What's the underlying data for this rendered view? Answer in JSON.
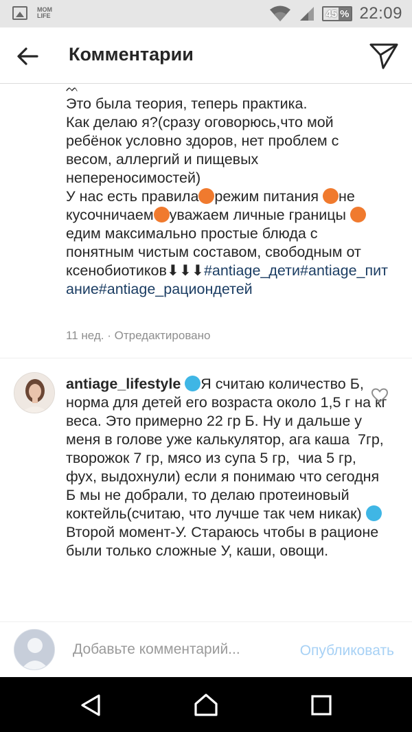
{
  "status_bar": {
    "left_icons": [
      "gallery-icon",
      "mom-life-app-icon"
    ],
    "mom_life_label": "MOM LIFE",
    "battery_percent_text": "45 %",
    "battery_level": 0.45,
    "time": "22:09"
  },
  "header": {
    "title": "Комментарии",
    "back_icon": "arrow-left-icon",
    "send_icon": "paper-plane-icon"
  },
  "comments": [
    {
      "partial_top_glyph": "ᨓ",
      "text_before": "Это была теория, теперь практика.\nКак делаю я?(сразу оговорюсь,что мой ребёнок условно здоров, нет проблем с весом, аллергий и пищевых непереносимостей)\nУ нас есть правила",
      "seg1": "режим питания ",
      "seg2": "не кусочничаем",
      "seg3": "уважаем личные границы ",
      "seg4": "едим максимально простые блюда с понятным чистым составом, свободным от ксенобиотиков⬇⬇⬇",
      "tags": "#antiage_дети#antiage_питание#antiage_рациондетей",
      "time": "11 нед.",
      "edited": "· Отредактировано",
      "dot_color": "#f07a2e"
    },
    {
      "username": "antiage_lifestyle",
      "text_part1": "Я считаю количество Б, норма для детей его возраста около 1,5 г на кг веса. Это примерно 22 гр Б. Ну и дальше у меня в голове уже калькулятор, ага каша  7гр, творожок 7 гр, мясо из супа 5 гр,  чиа 5 гр, фух, выдохнули) если я понимаю что сегодня Б мы не добрали, то делаю протеиновый коктейль(считаю, что лучше так чем никак) ",
      "text_part2": "Второй момент-У. Стараюсь чтобы в рационе были только сложные У, каши, овощи.",
      "dot_color": "#3fb6e5",
      "like_icon": "heart-outline-icon"
    }
  ],
  "comment_input": {
    "placeholder": "Добавьте комментарий...",
    "value": "",
    "publish_label": "Опубликовать"
  },
  "nav_bar": {
    "icons": [
      "triangle-back-icon",
      "home-pentagon-icon",
      "square-recents-icon"
    ]
  }
}
